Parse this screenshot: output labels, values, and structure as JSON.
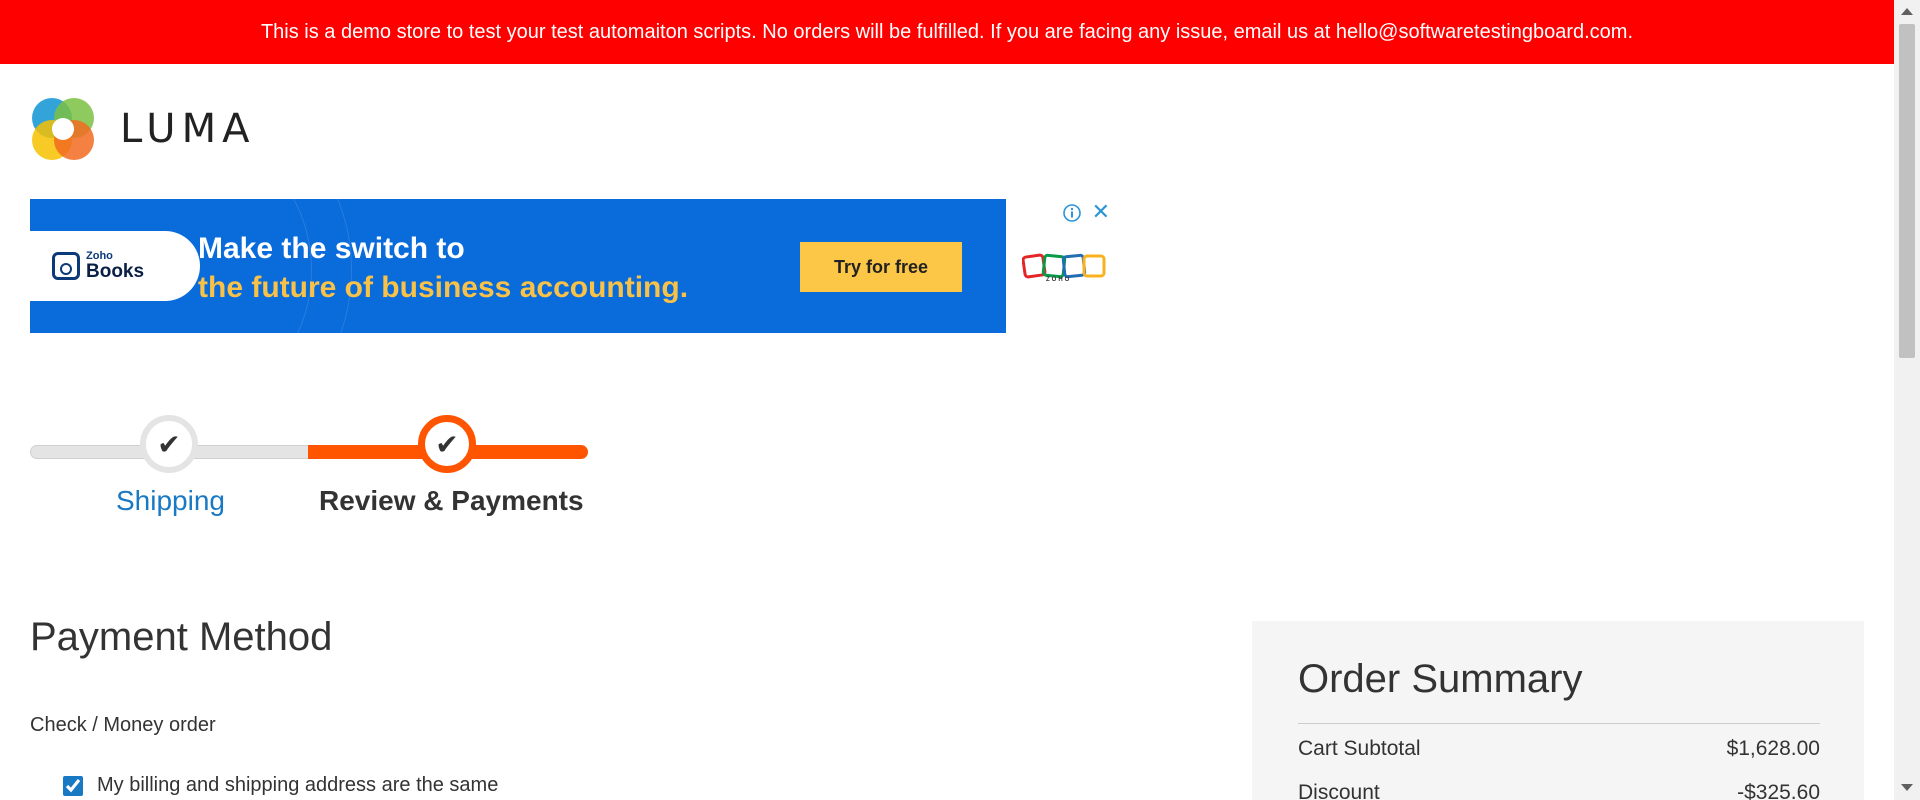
{
  "banner": {
    "text": "This is a demo store to test your test automaiton scripts. No orders will be fulfilled. If you are facing any issue, email us at hello@softwaretestingboard.com."
  },
  "header": {
    "logo_text": "LUMA"
  },
  "ad": {
    "brand_small": "Zoho",
    "brand_big": "Books",
    "headline_line1": "Make the switch to",
    "headline_line2": "the future of business accounting.",
    "cta": "Try for free",
    "zoho_wordmark": "ZOHO"
  },
  "progress": {
    "steps": [
      {
        "label": "Shipping",
        "state": "complete"
      },
      {
        "label": "Review & Payments",
        "state": "active"
      }
    ]
  },
  "payment": {
    "title": "Payment Method",
    "method_label": "Check / Money order",
    "billing_same_label": "My billing and shipping address are the same",
    "billing_same_checked": true
  },
  "summary": {
    "title": "Order Summary",
    "rows": [
      {
        "label": "Cart Subtotal",
        "value": "$1,628.00"
      },
      {
        "label": "Discount",
        "value": "-$325.60"
      }
    ]
  },
  "colors": {
    "banner_bg": "#ff0000",
    "accent_orange": "#ff5501",
    "link_blue": "#1979c3",
    "ad_blue": "#0a6bdb",
    "ad_yellow": "#fcc647"
  }
}
